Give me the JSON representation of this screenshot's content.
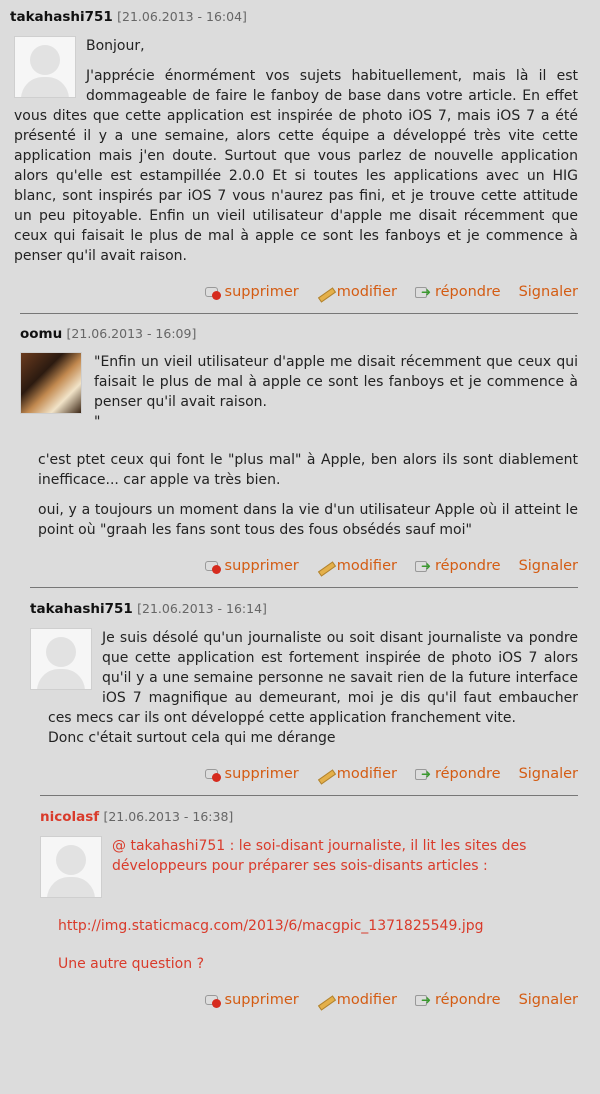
{
  "actions": {
    "delete": "supprimer",
    "edit": "modifier",
    "reply": "répondre",
    "report": "Signaler"
  },
  "comments": [
    {
      "author": "takahashi751",
      "date": "[21.06.2013 - 16:04]",
      "paragraphs": [
        "Bonjour,",
        "J'apprécie énormément vos sujets habituellement, mais là il est dommageable de faire le fanboy de base dans votre article. En effet vous dites que cette application est inspirée de photo iOS 7, mais iOS 7 a été présenté il y a une semaine, alors cette équipe a développé très vite cette application mais j'en doute. Surtout que vous parlez de nouvelle application alors qu'elle est estampillée 2.0.0 Et si toutes les applications avec un HIG blanc, sont inspirés par iOS 7 vous n'aurez pas fini, et je trouve cette attitude un peu pitoyable. Enfin un vieil utilisateur d'apple me disait récemment que ceux qui faisait le plus de mal à apple ce sont les fanboys et je commence à penser qu'il avait raison."
      ]
    },
    {
      "author": "oomu",
      "date": "[21.06.2013 - 16:09]",
      "paragraphs": [
        "\"Enfin un vieil utilisateur d'apple me disait récemment que ceux qui faisait le plus de mal à apple ce sont les fanboys et je commence à penser qu'il avait raison.\n\"",
        "c'est ptet ceux qui font le \"plus mal\" à Apple, ben alors ils sont diablement inefficace... car apple va très bien.",
        "oui, y a toujours un moment dans la vie d'un utilisateur Apple où il atteint le point où \"graah les fans sont tous des fous obsédés sauf moi\""
      ]
    },
    {
      "author": "takahashi751",
      "date": "[21.06.2013 - 16:14]",
      "paragraphs": [
        "Je suis désolé qu'un journaliste ou soit disant journaliste va pondre que cette application est fortement inspirée de photo iOS 7 alors qu'il y a une semaine personne ne savait rien de la future interface iOS 7 magnifique au demeurant, moi je dis qu'il faut embaucher ces mecs car ils ont développé cette application franchement vite.\nDonc c'était surtout cela qui me dérange"
      ]
    },
    {
      "author": "nicolasf",
      "date": "[21.06.2013 - 16:38]",
      "paragraphs": [
        "@ takahashi751 : le soi-disant journaliste, il lit les sites des développeurs pour préparer ses sois-disants articles :",
        "http://img.staticmacg.com/2013/6/macgpic_1371825549.jpg",
        "Une autre question ?"
      ]
    }
  ]
}
